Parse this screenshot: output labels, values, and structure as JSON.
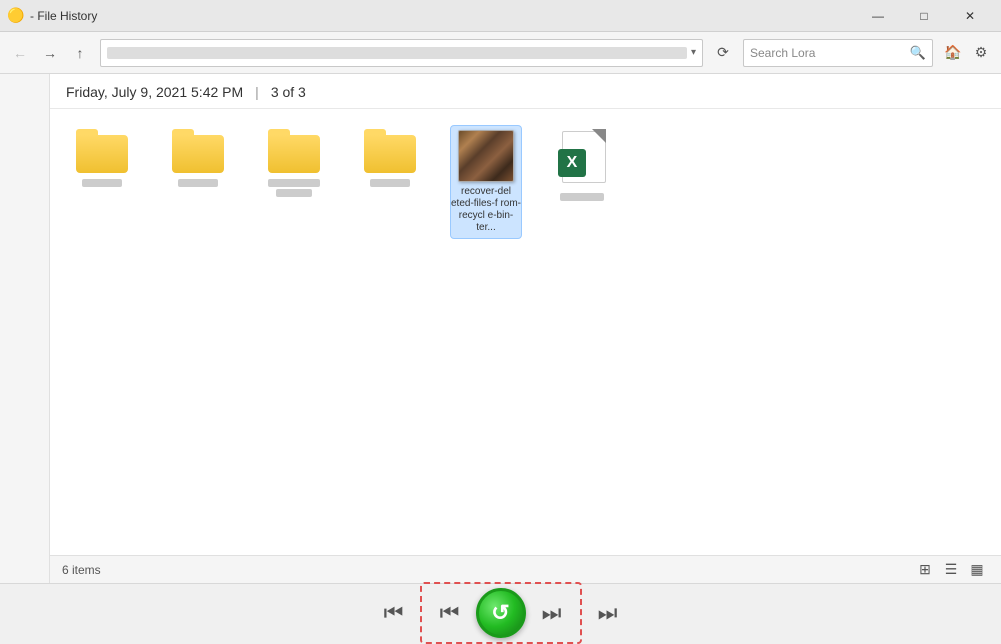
{
  "titleBar": {
    "icon": "🟡",
    "title": "- File History",
    "minimizeLabel": "—",
    "maximizeLabel": "□",
    "closeLabel": "✕"
  },
  "navBar": {
    "backLabel": "←",
    "forwardLabel": "→",
    "upLabel": "↑",
    "addressPlaceholder": "address path",
    "refreshLabel": "⟳",
    "searchPlaceholder": "Search Lora",
    "searchLabel": "🔍",
    "homeLabel": "🏠",
    "settingsLabel": "⚙"
  },
  "dateHeader": {
    "date": "Friday, July 9, 2021 5:42 PM",
    "divider": "|",
    "pageInfo": "3 of 3"
  },
  "files": [
    {
      "type": "folder",
      "label": ""
    },
    {
      "type": "folder",
      "label": ""
    },
    {
      "type": "folder",
      "label": ""
    },
    {
      "type": "folder",
      "label": ""
    },
    {
      "type": "image",
      "label": "recover-deleted-files-from-recycle-bin-ter..."
    },
    {
      "type": "excel",
      "label": ""
    }
  ],
  "statusBar": {
    "itemCount": "6 items"
  },
  "bottomBar": {
    "prevLabel": "⏮",
    "nextLabel": "⏭",
    "restoreLabel": "↺"
  }
}
